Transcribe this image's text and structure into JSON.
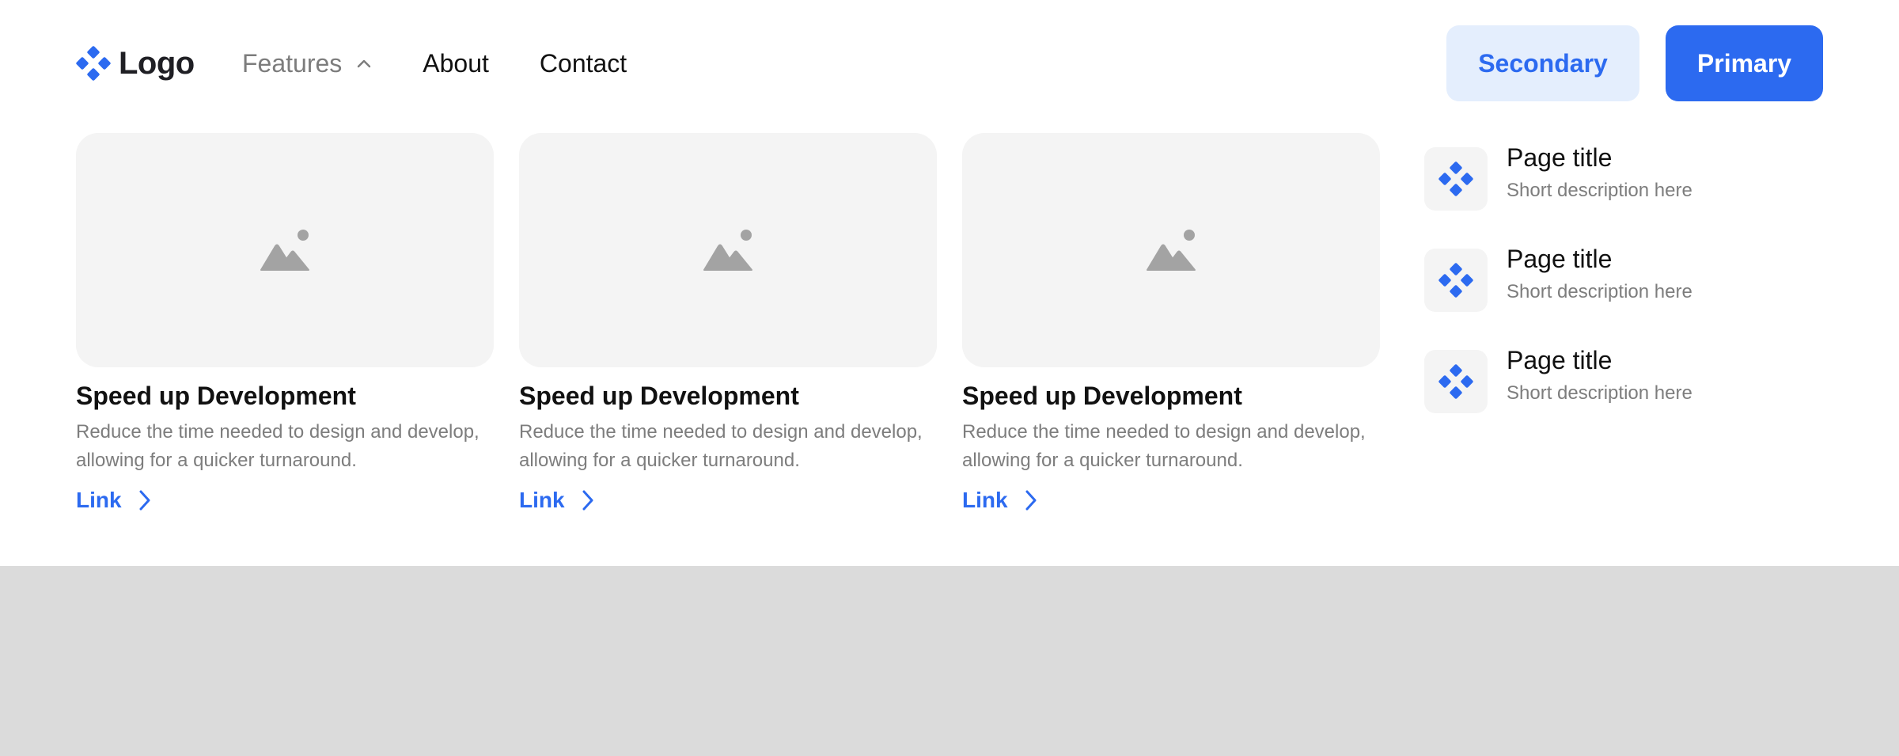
{
  "colors": {
    "accent": "#2c6af0",
    "secondary_bg": "#e4eefd",
    "placeholder_bg": "#f4f4f4",
    "backdrop": "#dbdbdb"
  },
  "header": {
    "logo_text": "Logo",
    "nav": [
      {
        "label": "Features",
        "icon": "chevron-up-icon",
        "active": true
      },
      {
        "label": "About"
      },
      {
        "label": "Contact"
      }
    ],
    "secondary_button": "Secondary",
    "primary_button": "Primary"
  },
  "cards": [
    {
      "image_icon": "image-placeholder-icon",
      "title": "Speed up Development",
      "description": "Reduce the time needed to design and develop, allowing for a quicker turnaround.",
      "link": "Link"
    },
    {
      "image_icon": "image-placeholder-icon",
      "title": "Speed up Development",
      "description": "Reduce the time needed to design and develop, allowing for a quicker turnaround.",
      "link": "Link"
    },
    {
      "image_icon": "image-placeholder-icon",
      "title": "Speed up Development",
      "description": "Reduce the time needed to design and develop, allowing for a quicker turnaround.",
      "link": "Link"
    }
  ],
  "pages": [
    {
      "icon": "logo-diamond-icon",
      "title": "Page title",
      "description": "Short description here"
    },
    {
      "icon": "logo-diamond-icon",
      "title": "Page title",
      "description": "Short description here"
    },
    {
      "icon": "logo-diamond-icon",
      "title": "Page title",
      "description": "Short description here"
    }
  ]
}
